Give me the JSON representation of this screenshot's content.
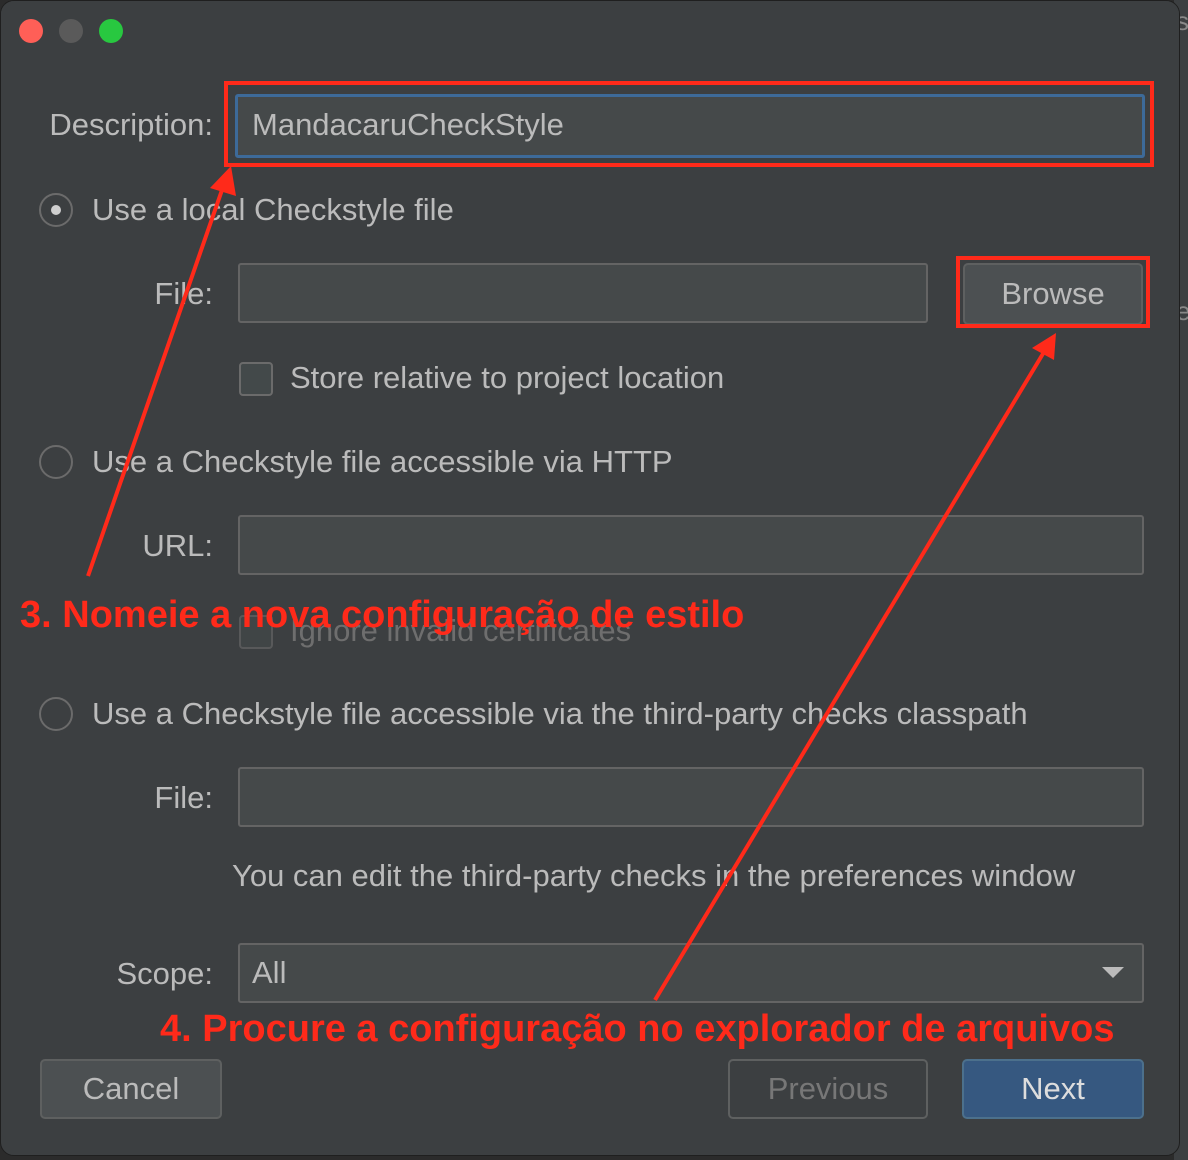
{
  "dialog": {
    "description_label": "Description:",
    "description_value": "MandacaruCheckStyle",
    "local_option_label": "Use a local Checkstyle file",
    "file_label": "File:",
    "local_file_value": "",
    "browse_label": "Browse",
    "store_relative_label": "Store relative to project location",
    "http_option_label": "Use a Checkstyle file accessible via HTTP",
    "url_label": "URL:",
    "url_value": "",
    "ignore_certificates_label": "Ignore invalid certificates",
    "classpath_option_label": "Use a Checkstyle file accessible via the third-party checks classpath",
    "classpath_file_label": "File:",
    "classpath_file_value": "",
    "third_party_hint": "You can edit the third-party checks in the preferences window",
    "scope_label": "Scope:",
    "scope_value": "All"
  },
  "buttons": {
    "cancel": "Cancel",
    "previous": "Previous",
    "next": "Next"
  },
  "annotations": {
    "step3": "3. Nomeie a nova configuração de estilo",
    "step4": "4. Procure a configuração no explorador de arquivos",
    "color": "#ff2a1a"
  },
  "backdrop_glyphs": [
    "s",
    "i",
    "e"
  ],
  "colors": {
    "window_bg": "#3c3f41",
    "primary_button": "#365880",
    "focus_border": "#3d6a99"
  }
}
